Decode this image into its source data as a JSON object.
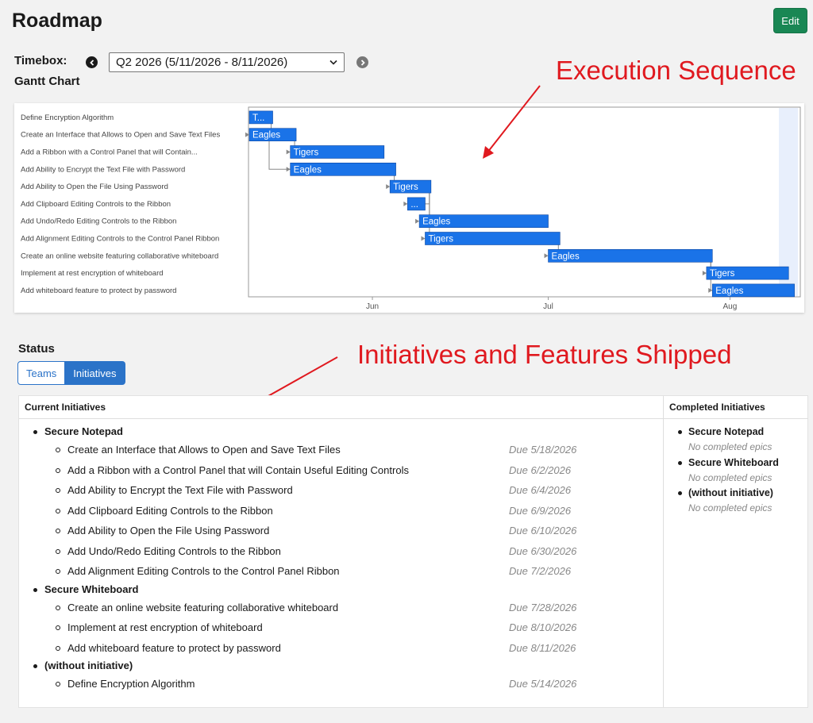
{
  "header": {
    "title": "Roadmap",
    "edit_label": "Edit"
  },
  "timebox": {
    "label": "Timebox:",
    "selected": "Q2 2026 (5/11/2026 - 8/11/2026)",
    "prev_icon": "chevron-left-circle-icon",
    "next_icon": "chevron-right-circle-icon"
  },
  "gantt": {
    "title": "Gantt Chart",
    "bar_color": "#1a73e8",
    "month_labels": [
      "Jun",
      "Jul",
      "Aug"
    ],
    "tasks": [
      {
        "name": "Define Encryption Algorithm",
        "team": "T...",
        "start": "5/11/2026",
        "end": "5/14/2026"
      },
      {
        "name": "Create an Interface that Allows to Open and Save Text Files",
        "team": "Eagles",
        "start": "5/11/2026",
        "end": "5/18/2026"
      },
      {
        "name": "Add a Ribbon with a Control Panel that will Contain...",
        "team": "Tigers",
        "start": "5/18/2026",
        "end": "6/2/2026"
      },
      {
        "name": "Add Ability to Encrypt the Text File with Password",
        "team": "Eagles",
        "start": "5/18/2026",
        "end": "6/4/2026"
      },
      {
        "name": "Add Ability to Open the File Using Password",
        "team": "Tigers",
        "start": "6/4/2026",
        "end": "6/10/2026"
      },
      {
        "name": "Add Clipboard Editing Controls to the Ribbon",
        "team": "...",
        "start": "6/7/2026",
        "end": "6/9/2026"
      },
      {
        "name": "Add Undo/Redo Editing Controls to the Ribbon",
        "team": "Eagles",
        "start": "6/9/2026",
        "end": "6/30/2026"
      },
      {
        "name": "Add Alignment Editing Controls to the Control Panel Ribbon",
        "team": "Tigers",
        "start": "6/10/2026",
        "end": "7/2/2026"
      },
      {
        "name": "Create an online website featuring collaborative whiteboard",
        "team": "Eagles",
        "start": "7/1/2026",
        "end": "7/28/2026"
      },
      {
        "name": "Implement at rest encryption of whiteboard",
        "team": "Tigers",
        "start": "7/28/2026",
        "end": "8/10/2026"
      },
      {
        "name": "Add whiteboard feature to protect by password",
        "team": "Eagles",
        "start": "7/29/2026",
        "end": "8/11/2026"
      }
    ]
  },
  "annotations": {
    "execution": "Execution Sequence",
    "initiatives": "Initiatives and Features Shipped",
    "color": "#e0191f"
  },
  "status": {
    "title": "Status",
    "toggle": {
      "teams": "Teams",
      "initiatives": "Initiatives",
      "active": "Initiatives"
    },
    "current_header": "Current Initiatives",
    "completed_header": "Completed Initiatives",
    "current": [
      {
        "name": "Secure Notepad",
        "features": [
          {
            "name": "Create an Interface that Allows to Open and Save Text Files",
            "due": "Due 5/18/2026"
          },
          {
            "name": "Add a Ribbon with a Control Panel that will Contain Useful Editing Controls",
            "due": "Due 6/2/2026"
          },
          {
            "name": "Add Ability to Encrypt the Text File with Password",
            "due": "Due 6/4/2026"
          },
          {
            "name": "Add Clipboard Editing Controls to the Ribbon",
            "due": "Due 6/9/2026"
          },
          {
            "name": "Add Ability to Open the File Using Password",
            "due": "Due 6/10/2026"
          },
          {
            "name": "Add Undo/Redo Editing Controls to the Ribbon",
            "due": "Due 6/30/2026"
          },
          {
            "name": "Add Alignment Editing Controls to the Control Panel Ribbon",
            "due": "Due 7/2/2026"
          }
        ]
      },
      {
        "name": "Secure Whiteboard",
        "features": [
          {
            "name": "Create an online website featuring collaborative whiteboard",
            "due": "Due 7/28/2026"
          },
          {
            "name": "Implement at rest encryption of whiteboard",
            "due": "Due 8/10/2026"
          },
          {
            "name": "Add whiteboard feature to protect by password",
            "due": "Due 8/11/2026"
          }
        ]
      },
      {
        "name": "(without initiative)",
        "features": [
          {
            "name": "Define Encryption Algorithm",
            "due": "Due 5/14/2026"
          }
        ]
      }
    ],
    "completed": [
      {
        "name": "Secure Notepad",
        "note": "No completed epics"
      },
      {
        "name": "Secure Whiteboard",
        "note": "No completed epics"
      },
      {
        "name": "(without initiative)",
        "note": "No completed epics"
      }
    ]
  }
}
